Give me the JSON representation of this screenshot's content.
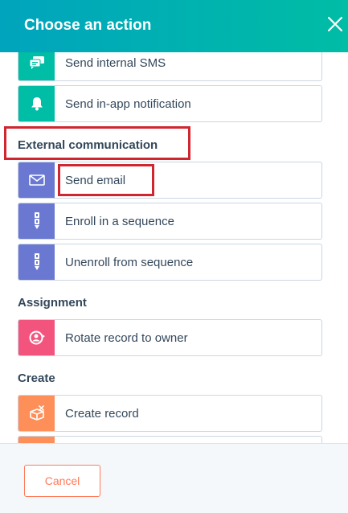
{
  "header": {
    "title": "Choose an action",
    "close_icon": "close-icon"
  },
  "colors": {
    "teal": "#00bda5",
    "header_gradient_start": "#00a4bd",
    "purple": "#6a78d1",
    "pink": "#f2547d",
    "orange": "#ff8f59",
    "highlight_red": "#d0262f",
    "cancel_orange": "#ff7a59"
  },
  "actions": {
    "send_sms": {
      "label": "Send internal SMS",
      "icon": "chat-icon"
    },
    "send_in_app": {
      "label": "Send in-app notification",
      "icon": "bell-icon"
    },
    "send_email": {
      "label": "Send email",
      "icon": "envelope-icon"
    },
    "enroll_sequence": {
      "label": "Enroll in a sequence",
      "icon": "sequence-icon"
    },
    "unenroll_sequence": {
      "label": "Unenroll from sequence",
      "icon": "sequence-icon"
    },
    "rotate_owner": {
      "label": "Rotate record to owner",
      "icon": "rotate-owner-icon"
    },
    "create_record": {
      "label": "Create record",
      "icon": "create-record-icon"
    }
  },
  "sections": {
    "external": "External communication",
    "assignment": "Assignment",
    "create": "Create"
  },
  "footer": {
    "cancel_label": "Cancel"
  }
}
